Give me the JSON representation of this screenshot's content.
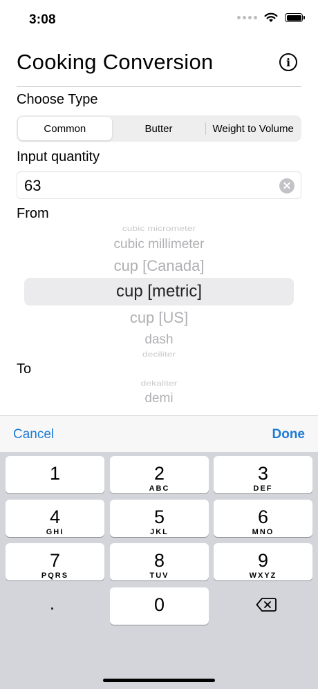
{
  "status": {
    "time": "3:08",
    "icons": [
      "signal-dots-icon",
      "wifi-icon",
      "battery-icon"
    ]
  },
  "header": {
    "title": "Cooking Conversion",
    "info_icon": "info-icon"
  },
  "type_section": {
    "label": "Choose Type",
    "segments": [
      {
        "label": "Common",
        "selected": true
      },
      {
        "label": "Butter",
        "selected": false
      },
      {
        "label": "Weight to Volume",
        "selected": false
      }
    ]
  },
  "input_section": {
    "label": "Input quantity",
    "value": "63",
    "clear_icon": "clear-icon"
  },
  "from_section": {
    "label": "From",
    "items": [
      "cubic micrometer",
      "cubic millimeter",
      "cup [Canada]",
      "cup [metric]",
      "cup [US]",
      "dash",
      "deciliter"
    ],
    "selected": "cup [metric]"
  },
  "to_section": {
    "label": "To",
    "items": [
      "dekaliter",
      "demi"
    ]
  },
  "accessory": {
    "cancel": "Cancel",
    "done": "Done"
  },
  "keyboard": {
    "keys": [
      {
        "digit": "1",
        "letters": ""
      },
      {
        "digit": "2",
        "letters": "ABC"
      },
      {
        "digit": "3",
        "letters": "DEF"
      },
      {
        "digit": "4",
        "letters": "GHI"
      },
      {
        "digit": "5",
        "letters": "JKL"
      },
      {
        "digit": "6",
        "letters": "MNO"
      },
      {
        "digit": "7",
        "letters": "PQRS"
      },
      {
        "digit": "8",
        "letters": "TUV"
      },
      {
        "digit": "9",
        "letters": "WXYZ"
      },
      {
        "digit": "0",
        "letters": ""
      }
    ],
    "decimal": ".",
    "delete_icon": "backspace-icon"
  },
  "colors": {
    "accent": "#1d7bd7",
    "keyboard_bg": "#d3d5db",
    "segment_bg": "#eeeeef"
  }
}
